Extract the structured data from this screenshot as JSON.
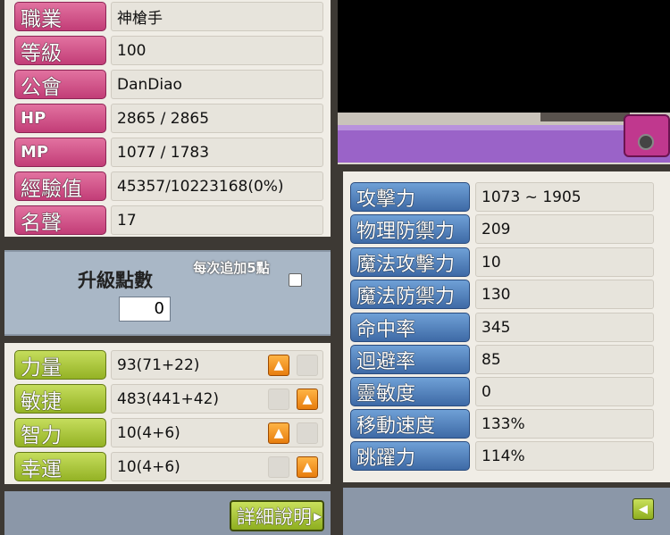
{
  "info": [
    {
      "label": "職業",
      "value": "神槍手"
    },
    {
      "label": "等級",
      "value": "100"
    },
    {
      "label": "公會",
      "value": "DanDiao"
    },
    {
      "label": "HP",
      "value": "2865 / 2865"
    },
    {
      "label": "MP",
      "value": "1077 / 1783"
    },
    {
      "label": "經驗值",
      "value": "45357/10223168(0%)"
    },
    {
      "label": "名聲",
      "value": "17"
    }
  ],
  "points": {
    "label": "升級點數",
    "value": "0",
    "auto_label": "每次追加5點"
  },
  "stats": [
    {
      "label": "力量",
      "value": "93(71+22)",
      "up_enabled": true
    },
    {
      "label": "敏捷",
      "value": "483(441+42)",
      "up_enabled": true
    },
    {
      "label": "智力",
      "value": "10(4+6)",
      "up_enabled": true
    },
    {
      "label": "幸運",
      "value": "10(4+6)",
      "up_enabled": true
    }
  ],
  "detail_button": "詳細說明",
  "detail_stats": [
    {
      "label": "攻擊力",
      "value": "1073 ~ 1905"
    },
    {
      "label": "物理防禦力",
      "value": "209"
    },
    {
      "label": "魔法攻擊力",
      "value": "10"
    },
    {
      "label": "魔法防禦力",
      "value": "130"
    },
    {
      "label": "命中率",
      "value": "345"
    },
    {
      "label": "迴避率",
      "value": "85"
    },
    {
      "label": "靈敏度",
      "value": "0"
    },
    {
      "label": "移動速度",
      "value": "133%"
    },
    {
      "label": "跳躍力",
      "value": "114%"
    }
  ],
  "colors": {
    "pink_tag": "#c23d77",
    "green_tag": "#94b225",
    "blue_tag": "#3e6aa6",
    "up_button": "#e77d0e"
  },
  "icons": {
    "up": "up-arrow-icon",
    "collapse": "left-arrow-icon"
  }
}
